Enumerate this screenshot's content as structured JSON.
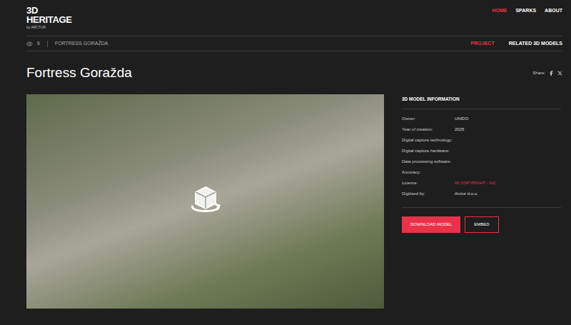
{
  "logo": {
    "lines": [
      "3D",
      "HERITAGE"
    ],
    "byline": "by ARCTUR"
  },
  "nav": [
    {
      "label": "HOME",
      "selected": true
    },
    {
      "label": "SPARKS",
      "selected": false
    },
    {
      "label": "ABOUT",
      "selected": false
    }
  ],
  "breadcrumb": {
    "views": "6",
    "current": "FORTRESS GORAŽDA"
  },
  "tabs": [
    {
      "label": "PROJECT",
      "selected": true
    },
    {
      "label": "RELATED 3D MODELS",
      "selected": false
    }
  ],
  "title": "Fortress Goražda",
  "share": {
    "label": "Share:"
  },
  "info": {
    "heading": "3D MODEL INFORMATION",
    "rows": [
      {
        "label": "Owner:",
        "value": "UNIDO",
        "link": false
      },
      {
        "label": "Year of creation:",
        "value": "2025",
        "link": false
      },
      {
        "label": "Digital capture technology:",
        "value": "",
        "link": false
      },
      {
        "label": "Digital capture hardware:",
        "value": "",
        "link": false
      },
      {
        "label": "Data processing software:",
        "value": "",
        "link": false
      },
      {
        "label": "Accuracy:",
        "value": "",
        "link": false
      },
      {
        "label": "Licence:",
        "value": "IN COPYRIGHT - InC",
        "link": true
      },
      {
        "label": "Digitised by:",
        "value": "Arctur d.o.o.",
        "link": false
      }
    ]
  },
  "buttons": [
    {
      "label": "DOWNLOAD MODEL",
      "kind": "primary"
    },
    {
      "label": "EMBED",
      "kind": "outline"
    }
  ]
}
